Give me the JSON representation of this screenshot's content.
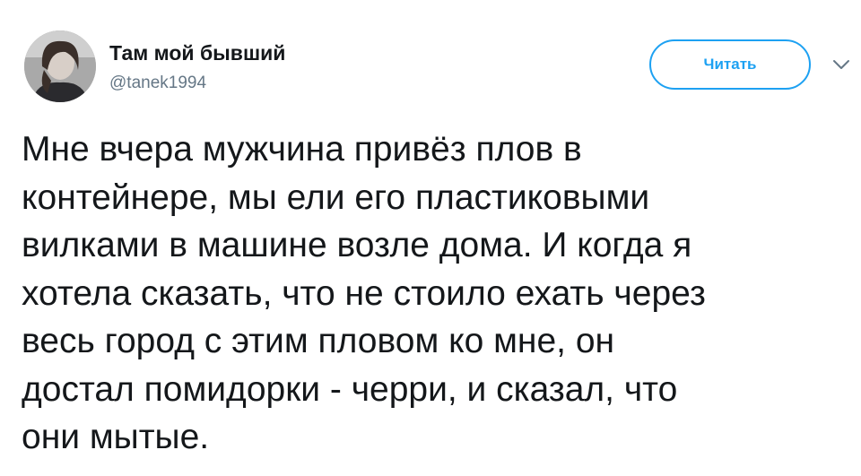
{
  "author": {
    "display_name": "Там мой бывший",
    "handle": "@tanek1994",
    "avatar_icon": "user-avatar-photo"
  },
  "follow_button": {
    "label": "Читать",
    "color": "#1da1f2"
  },
  "menu": {
    "icon": "chevron-down-icon"
  },
  "tweet": {
    "lines": [
      "Мне вчера мужчина привёз плов в",
      "контейнере, мы ели его пластиковыми",
      "вилками в машине возле дома. И когда я",
      "хотела сказать, что не стоило ехать через",
      "весь город с этим пловом ко мне, он",
      "достал помидорки - черри, и сказал, что",
      "они мытые."
    ]
  },
  "colors": {
    "text": "#14171a",
    "secondary": "#657786",
    "accent": "#1da1f2"
  }
}
